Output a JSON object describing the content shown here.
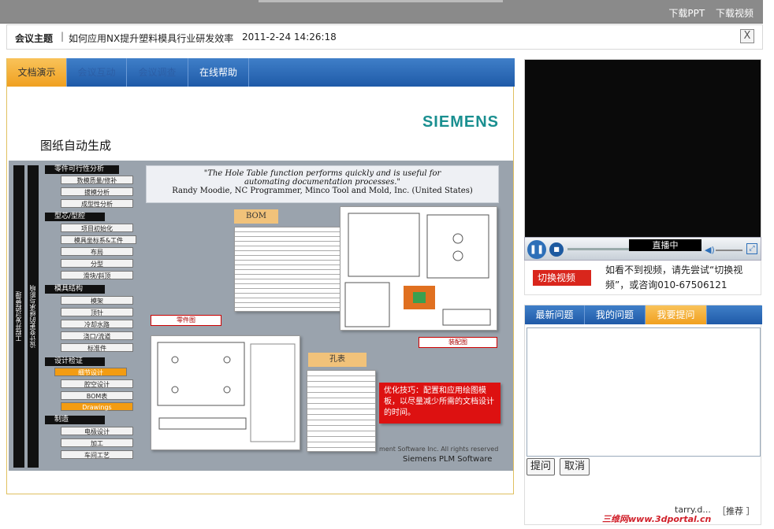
{
  "header": {
    "download_ppt": "下载PPT",
    "download_video": "下载视频"
  },
  "meeting": {
    "label": "会议主题",
    "separator": "|",
    "topic": "如何应用NX提升塑料模具行业研发效率",
    "time": "2011-2-24 14:26:18",
    "close_glyph": "X"
  },
  "tabs": [
    {
      "label": "文档演示"
    },
    {
      "label": "会议互动"
    },
    {
      "label": "会议调查"
    },
    {
      "label": "在线帮助"
    }
  ],
  "slide": {
    "brand": "SIEMENS",
    "title": "图纸自动生成",
    "vertical_1": "工程开发过程管理",
    "vertical_2": "设计变更的继承与影响",
    "groups": [
      {
        "label": "零件可行性分析",
        "items": [
          "数模质量/修补",
          "拔模分析",
          "成型性分析"
        ]
      },
      {
        "label": "型芯/型腔",
        "items": [
          "项目初始化",
          "模具坐标系&工件",
          "布局",
          "分型",
          "滑块/斜顶"
        ]
      },
      {
        "label": "模具结构",
        "items": [
          "模架",
          "顶针",
          "冷却水路",
          "浇口/流道",
          "标准件"
        ]
      },
      {
        "label": "设计检证",
        "items": [
          "细节设计",
          "腔空设计",
          "BOM表",
          "Drawings"
        ]
      },
      {
        "label": "制造",
        "items": [
          "电极设计",
          "加工",
          "车间工艺"
        ]
      }
    ],
    "quote_line1": "\"The Hole Table function performs quickly and is useful for",
    "quote_line2": "automating documentation processes.\"",
    "quote_author": "Randy Moodie, NC Programmer, Minco Tool and Mold, Inc. (United States)",
    "callout_bom": "BOM",
    "callout_holes": "孔表",
    "tag_part": "零件图",
    "tag_assembly": "装配图",
    "tip": "优化技巧：配置和应用绘图模板，以尽量减少所需的文档设计的时间。",
    "copyright": "ment Software Inc. All rights reserved",
    "footer": "Siemens PLM Software"
  },
  "player": {
    "status": "直播中",
    "play_glyph": "❚❚",
    "stop_glyph": "■",
    "volume_glyph": "◀)",
    "fullscreen_glyph": "⤢",
    "switch_label": "切换视频",
    "hint": "如看不到视频，请先尝试“切换视频”，或咨询010-67506121"
  },
  "qa": {
    "tabs": [
      {
        "label": "最新问题"
      },
      {
        "label": "我的问题"
      },
      {
        "label": "我要提问"
      }
    ],
    "ask_button": "提问",
    "cancel_button": "取消",
    "user": "tarry.d...",
    "recommend": "［推荐 ］"
  },
  "watermark": "三维网www.3dportal.cn",
  "colors": {
    "accent_blue": "#1f5aa8",
    "tab_orange": "#f0a020",
    "alert_red": "#d9261c",
    "brand_teal": "#1a8f90"
  }
}
